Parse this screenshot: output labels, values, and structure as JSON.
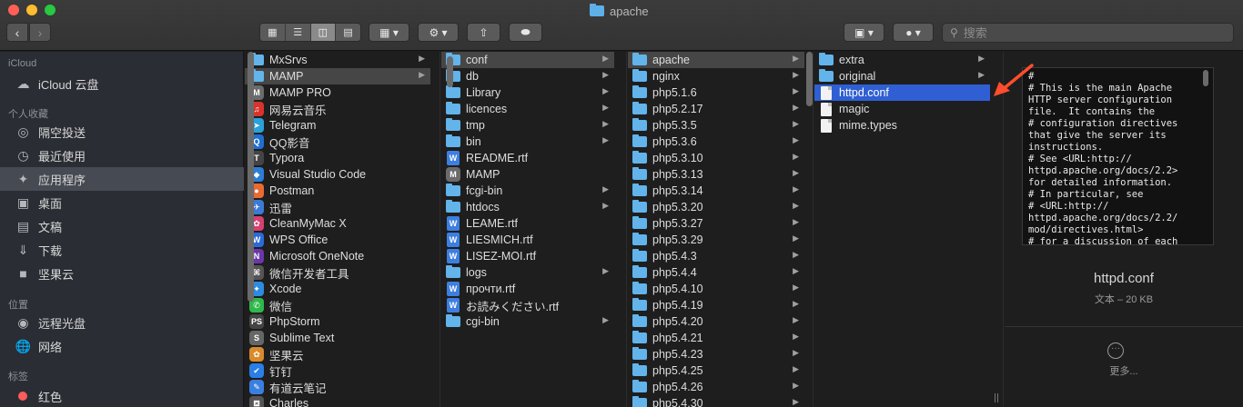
{
  "window": {
    "title": "apache"
  },
  "toolbar": {
    "search_placeholder": "搜索"
  },
  "sidebar": {
    "sections": [
      {
        "heading": "iCloud",
        "items": [
          {
            "label": "iCloud 云盘",
            "icon": "cloud-icon"
          }
        ]
      },
      {
        "heading": "个人收藏",
        "items": [
          {
            "label": "隔空投送",
            "icon": "airdrop-icon"
          },
          {
            "label": "最近使用",
            "icon": "clock-icon"
          },
          {
            "label": "应用程序",
            "icon": "applications-icon",
            "selected": true
          },
          {
            "label": "桌面",
            "icon": "desktop-icon"
          },
          {
            "label": "文稿",
            "icon": "documents-icon"
          },
          {
            "label": "下载",
            "icon": "download-icon"
          },
          {
            "label": "坚果云",
            "icon": "folder-icon"
          }
        ]
      },
      {
        "heading": "位置",
        "items": [
          {
            "label": "远程光盘",
            "icon": "disc-icon"
          },
          {
            "label": "网络",
            "icon": "network-icon"
          }
        ]
      },
      {
        "heading": "标签",
        "items": [
          {
            "label": "红色",
            "icon": "red-tag-icon"
          }
        ]
      }
    ]
  },
  "columns": {
    "apps": [
      {
        "label": "MxSrvs",
        "type": "folder",
        "arrow": true
      },
      {
        "label": "MAMP",
        "type": "folder",
        "arrow": true,
        "selected": "gray"
      },
      {
        "label": "MAMP PRO",
        "type": "app"
      },
      {
        "label": "网易云音乐",
        "type": "app"
      },
      {
        "label": "Telegram",
        "type": "app"
      },
      {
        "label": "QQ影音",
        "type": "app"
      },
      {
        "label": "Typora",
        "type": "app"
      },
      {
        "label": "Visual Studio Code",
        "type": "app"
      },
      {
        "label": "Postman",
        "type": "app"
      },
      {
        "label": "迅雷",
        "type": "app"
      },
      {
        "label": "CleanMyMac X",
        "type": "app"
      },
      {
        "label": "WPS Office",
        "type": "app"
      },
      {
        "label": "Microsoft OneNote",
        "type": "app"
      },
      {
        "label": "微信开发者工具",
        "type": "app"
      },
      {
        "label": "Xcode",
        "type": "app"
      },
      {
        "label": "微信",
        "type": "app"
      },
      {
        "label": "PhpStorm",
        "type": "app"
      },
      {
        "label": "Sublime Text",
        "type": "app"
      },
      {
        "label": "坚果云",
        "type": "app"
      },
      {
        "label": "钉钉",
        "type": "app"
      },
      {
        "label": "有道云笔记",
        "type": "app"
      },
      {
        "label": "Charles",
        "type": "app"
      }
    ],
    "mamp": [
      {
        "label": "conf",
        "type": "folder",
        "arrow": true,
        "selected": "gray"
      },
      {
        "label": "db",
        "type": "folder",
        "arrow": true
      },
      {
        "label": "Library",
        "type": "folder",
        "arrow": true
      },
      {
        "label": "licences",
        "type": "folder",
        "arrow": true
      },
      {
        "label": "tmp",
        "type": "folder",
        "arrow": true
      },
      {
        "label": "bin",
        "type": "folder",
        "arrow": true
      },
      {
        "label": "README.rtf",
        "type": "rtf"
      },
      {
        "label": "MAMP",
        "type": "app"
      },
      {
        "label": "fcgi-bin",
        "type": "folder",
        "arrow": true
      },
      {
        "label": "htdocs",
        "type": "folder",
        "arrow": true
      },
      {
        "label": "LEAME.rtf",
        "type": "rtf"
      },
      {
        "label": "LIESMICH.rtf",
        "type": "rtf"
      },
      {
        "label": "LISEZ-MOI.rtf",
        "type": "rtf"
      },
      {
        "label": "logs",
        "type": "folder",
        "arrow": true
      },
      {
        "label": "прочти.rtf",
        "type": "rtf"
      },
      {
        "label": "お読みください.rtf",
        "type": "rtf"
      },
      {
        "label": "cgi-bin",
        "type": "folder",
        "arrow": true
      }
    ],
    "conf": [
      {
        "label": "apache",
        "type": "folder",
        "arrow": true,
        "selected": "gray"
      },
      {
        "label": "nginx",
        "type": "folder",
        "arrow": true
      },
      {
        "label": "php5.1.6",
        "type": "folder",
        "arrow": true
      },
      {
        "label": "php5.2.17",
        "type": "folder",
        "arrow": true
      },
      {
        "label": "php5.3.5",
        "type": "folder",
        "arrow": true
      },
      {
        "label": "php5.3.6",
        "type": "folder",
        "arrow": true
      },
      {
        "label": "php5.3.10",
        "type": "folder",
        "arrow": true
      },
      {
        "label": "php5.3.13",
        "type": "folder",
        "arrow": true
      },
      {
        "label": "php5.3.14",
        "type": "folder",
        "arrow": true
      },
      {
        "label": "php5.3.20",
        "type": "folder",
        "arrow": true
      },
      {
        "label": "php5.3.27",
        "type": "folder",
        "arrow": true
      },
      {
        "label": "php5.3.29",
        "type": "folder",
        "arrow": true
      },
      {
        "label": "php5.4.3",
        "type": "folder",
        "arrow": true
      },
      {
        "label": "php5.4.4",
        "type": "folder",
        "arrow": true
      },
      {
        "label": "php5.4.10",
        "type": "folder",
        "arrow": true
      },
      {
        "label": "php5.4.19",
        "type": "folder",
        "arrow": true
      },
      {
        "label": "php5.4.20",
        "type": "folder",
        "arrow": true
      },
      {
        "label": "php5.4.21",
        "type": "folder",
        "arrow": true
      },
      {
        "label": "php5.4.23",
        "type": "folder",
        "arrow": true
      },
      {
        "label": "php5.4.25",
        "type": "folder",
        "arrow": true
      },
      {
        "label": "php5.4.26",
        "type": "folder",
        "arrow": true
      },
      {
        "label": "php5.4.30",
        "type": "folder",
        "arrow": true
      }
    ],
    "apache": [
      {
        "label": "extra",
        "type": "folder",
        "arrow": true
      },
      {
        "label": "original",
        "type": "folder",
        "arrow": true
      },
      {
        "label": "httpd.conf",
        "type": "doc",
        "selected": "blue"
      },
      {
        "label": "magic",
        "type": "doc"
      },
      {
        "label": "mime.types",
        "type": "doc"
      }
    ]
  },
  "preview": {
    "text": "#\n# This is the main Apache\nHTTP server configuration\nfile.  It contains the\n# configuration directives\nthat give the server its\ninstructions.\n# See <URL:http://\nhttpd.apache.org/docs/2.2>\nfor detailed information.\n# In particular, see\n# <URL:http://\nhttpd.apache.org/docs/2.2/\nmod/directives.html>\n# for a discussion of each",
    "file_name": "httpd.conf",
    "file_meta": "文本 – 20 KB",
    "more_label": "更多..."
  }
}
